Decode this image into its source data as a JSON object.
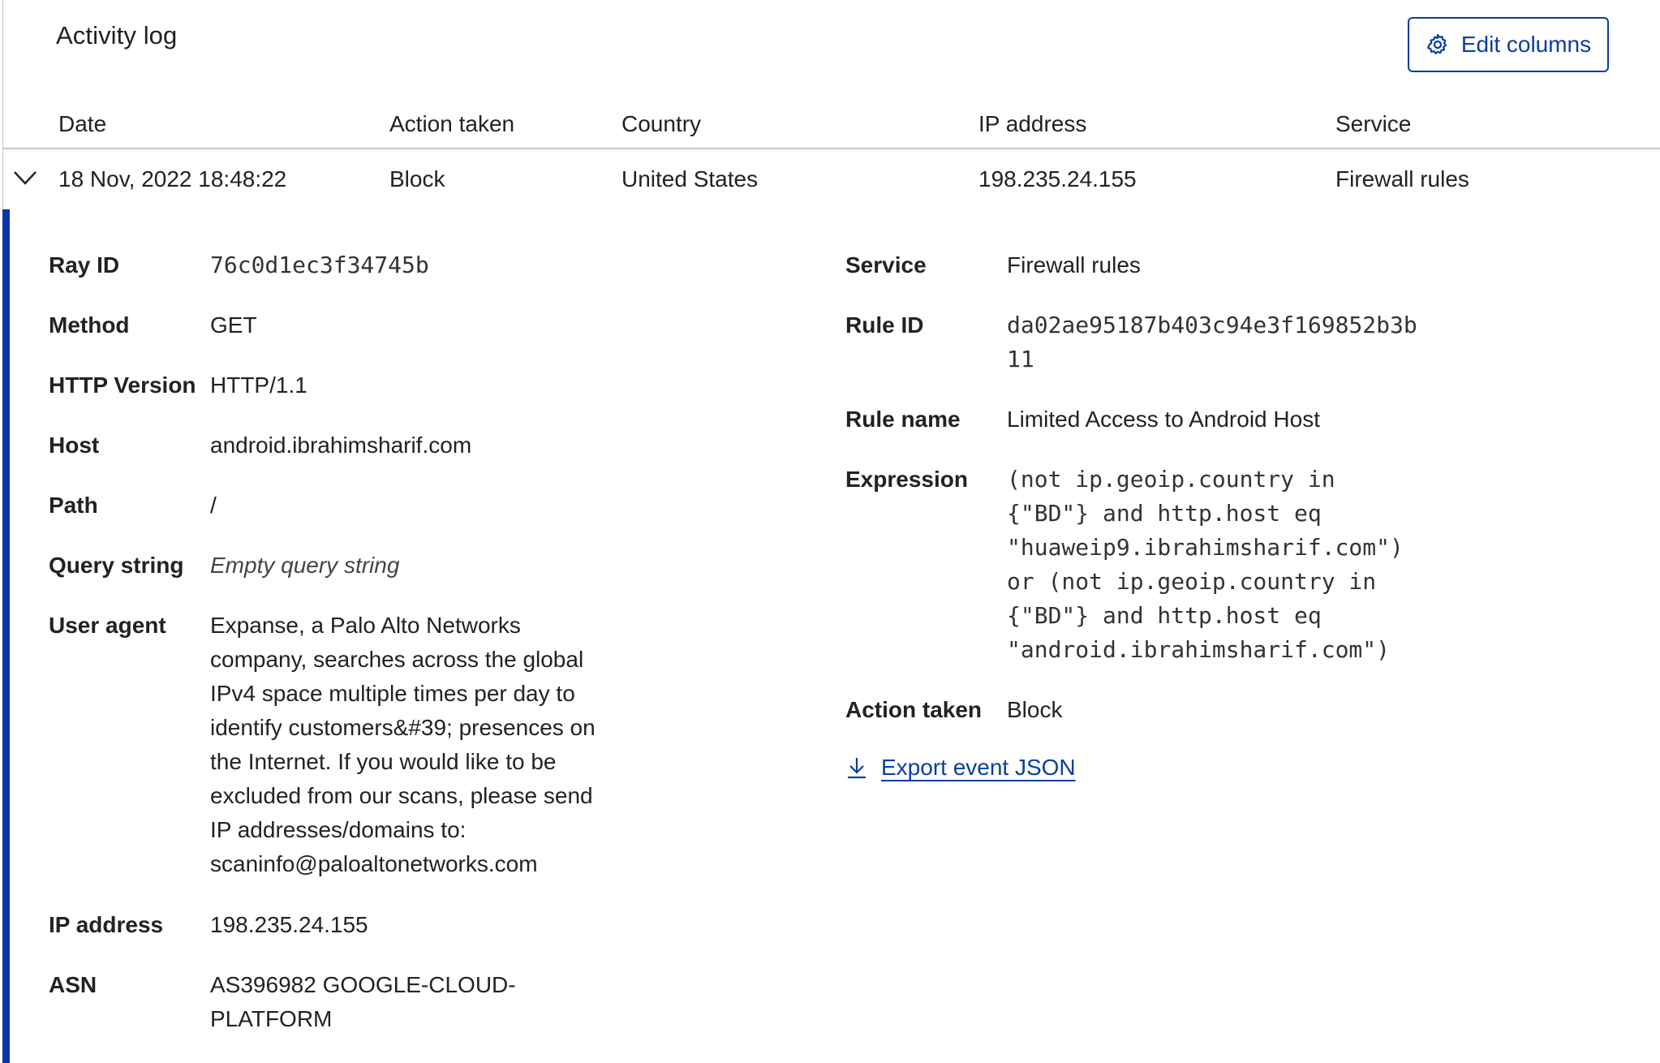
{
  "header": {
    "title": "Activity log",
    "edit_columns_label": "Edit columns"
  },
  "table": {
    "columns": [
      "Date",
      "Action taken",
      "Country",
      "IP address",
      "Service"
    ],
    "row": {
      "date": "18 Nov, 2022 18:48:22",
      "action": "Block",
      "country": "United States",
      "ip": "198.235.24.155",
      "service": "Firewall rules"
    }
  },
  "details": {
    "left": [
      {
        "label": "Ray ID",
        "value": "76c0d1ec3f34745b"
      },
      {
        "label": "Method",
        "value": "GET"
      },
      {
        "label": "HTTP Version",
        "value": "HTTP/1.1"
      },
      {
        "label": "Host",
        "value": "android.ibrahimsharif.com"
      },
      {
        "label": "Path",
        "value": "/"
      },
      {
        "label": "Query string",
        "value": "Empty query string"
      },
      {
        "label": "User agent",
        "lines": [
          "Expanse, a Palo Alto Networks",
          "company, searches across the global",
          "IPv4 space multiple times per day to",
          "identify customers&#39; presences on",
          "the Internet. If you would like to be",
          "excluded from our scans, please send",
          "IP addresses/domains to:",
          "scaninfo@paloaltonetworks.com"
        ]
      },
      {
        "label": "IP address",
        "value": "198.235.24.155"
      },
      {
        "label": "ASN",
        "lines": [
          "AS396982 GOOGLE-CLOUD-",
          "PLATFORM"
        ]
      }
    ],
    "right": [
      {
        "label": "Service",
        "value": "Firewall rules"
      },
      {
        "label": "Rule ID",
        "lines": [
          "da02ae95187b403c94e3f169852b3b",
          "11"
        ]
      },
      {
        "label": "Rule name",
        "value": "Limited Access to Android Host"
      },
      {
        "label": "Expression",
        "lines": [
          "(not ip.geoip.country in",
          "{\"BD\"} and http.host eq",
          "\"huaweip9.ibrahimsharif.com\")",
          "or (not ip.geoip.country in",
          "{\"BD\"} and http.host eq",
          "\"android.ibrahimsharif.com\")"
        ]
      },
      {
        "label": "Action taken",
        "value": "Block"
      }
    ],
    "export_label": "Export event JSON"
  },
  "colors": {
    "accent": "#0b3ea0",
    "expanded_bar": "#0b34a8",
    "rule": "#c8c8c8"
  }
}
